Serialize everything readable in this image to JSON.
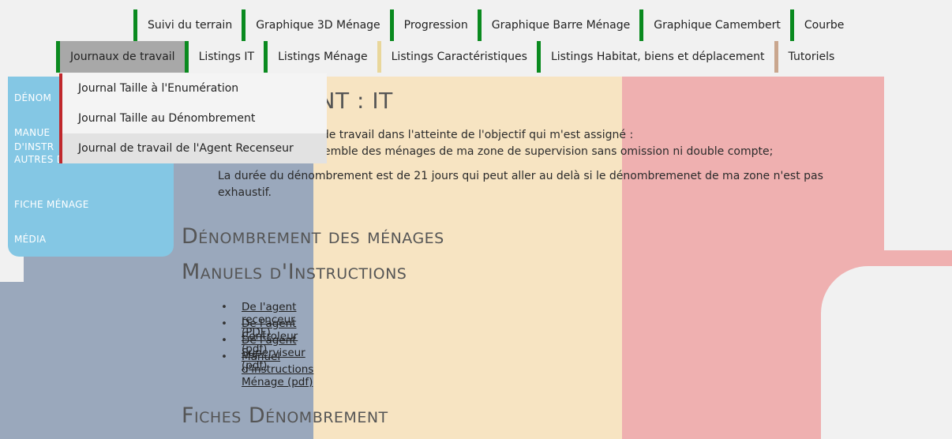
{
  "top_menu": {
    "row1": [
      {
        "label": "Suivi du terrain"
      },
      {
        "label": "Graphique 3D Ménage"
      },
      {
        "label": "Progression"
      },
      {
        "label": "Graphique Barre Ménage"
      },
      {
        "label": "Graphique Camembert"
      },
      {
        "label": "Courbe"
      }
    ],
    "row2": [
      {
        "label": "Journaux de travail"
      },
      {
        "label": "Listings IT"
      },
      {
        "label": "Listings Ménage"
      },
      {
        "label": "Listings Caractéristiques"
      },
      {
        "label": "Listings Habitat, biens et déplacement"
      },
      {
        "label": "Tutoriels"
      }
    ]
  },
  "dropdown": {
    "items": [
      {
        "label": "Journal Taille à l'Enumération"
      },
      {
        "label": "Journal Taille au Dénombrement"
      },
      {
        "label": "Journal de travail de l'Agent Recenseur"
      }
    ]
  },
  "sidebar": {
    "items": [
      {
        "label": "DÉNOM"
      },
      {
        "label": "MANUE"
      },
      {
        "label": "D'INSTR"
      },
      {
        "label": "AUTRES DOCUMENTS"
      },
      {
        "label": "FICHE MÉNAGE"
      },
      {
        "label": "MÉDIA"
      }
    ]
  },
  "main": {
    "title": "EMBREMENT : IT",
    "intro_line1": "zone de travail dans l'atteinte de l'objectif qui m'est assigné :",
    "intro_line2": "emble des ménages de ma zone de supervision sans omission ni double compte;",
    "intro_line3": "La durée du dénombrement est de 21 jours qui peut aller au delà si le dénombremenet de ma zone n'est pas",
    "intro_line4": "exhaustif.",
    "section1": "Dénombrement des ménages",
    "section2": "Manuels d'Instructions",
    "docs": [
      {
        "label": "De l'agent recenceur (PDF)"
      },
      {
        "label": "De l'agent Controleur (pdf)"
      },
      {
        "label": "De l'agent Superviseur (pdf)"
      },
      {
        "label": "Manuel d'instructions Ménage (pdf)"
      }
    ],
    "section3": "Fiches Dénombrement"
  },
  "colors": {
    "menu_border_green": "#0a8a1f",
    "dropdown_accent_red": "#c0282c",
    "sidebar_blue": "#84c7e4",
    "bg_blue": "#9aa8bc",
    "bg_yellow": "#f7e4c2",
    "bg_red": "#efb0b0"
  }
}
